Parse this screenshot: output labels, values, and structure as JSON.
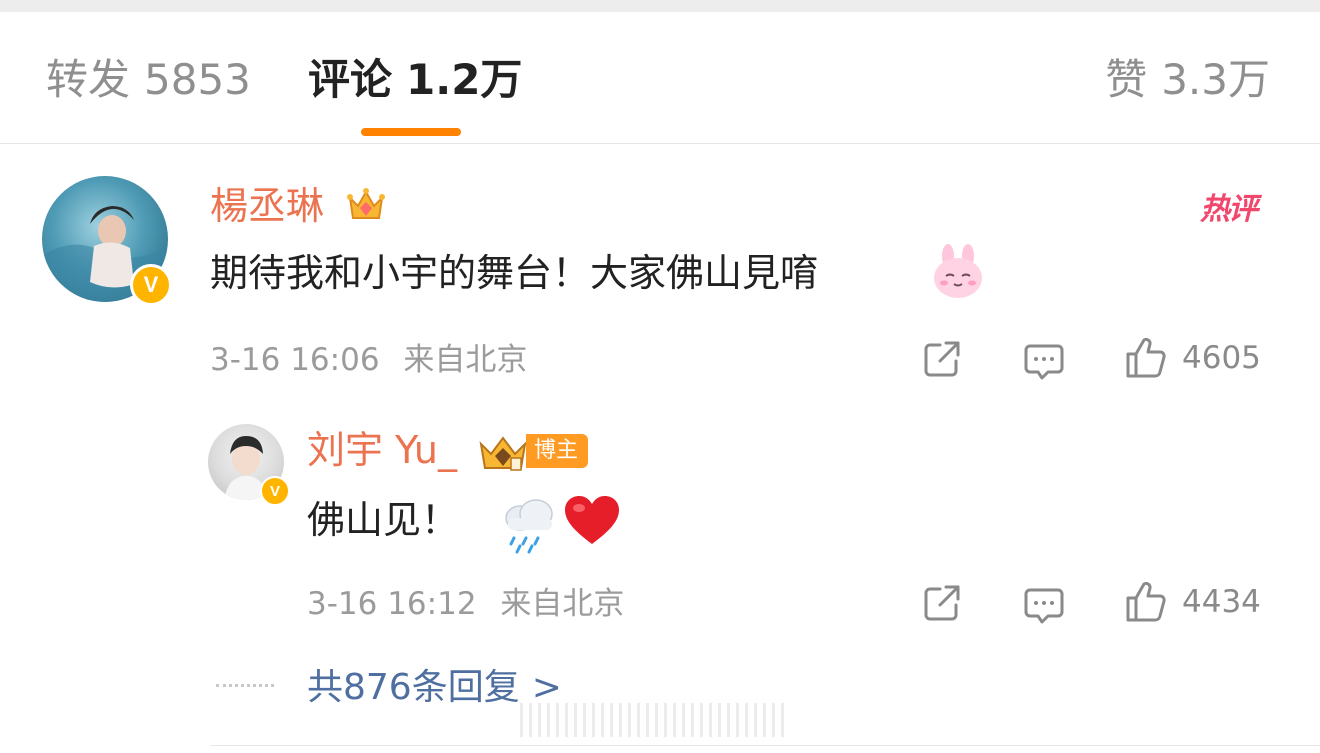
{
  "tabs": {
    "repost_label": "转发",
    "repost_count": "5853",
    "comment_label": "评论",
    "comment_count": "1.2万",
    "like_label": "赞",
    "like_count": "3.3万"
  },
  "colors": {
    "accent": "#ff8200",
    "username": "#eb7350",
    "link": "#4e6fa0",
    "hot": "#f2476d",
    "verified": "#ffb400"
  },
  "comment": {
    "username": "楊丞琳",
    "hot_label": "热评",
    "text": "期待我和小宇的舞台！大家佛山見唷",
    "emoji": "bunny-emoji",
    "time": "3-16 16:06",
    "location": "来自北京",
    "like_count": "4605",
    "icons": [
      "share-icon",
      "comment-icon",
      "like-icon"
    ]
  },
  "reply": {
    "username": "刘宇 Yu_",
    "badge": "博主",
    "text": "佛山见！",
    "emojis": [
      "rain-cloud-emoji",
      "heart-emoji"
    ],
    "time": "3-16 16:12",
    "location": "来自北京",
    "like_count": "4434"
  },
  "more_replies": {
    "label": "共876条回复",
    "chevron": ">"
  }
}
